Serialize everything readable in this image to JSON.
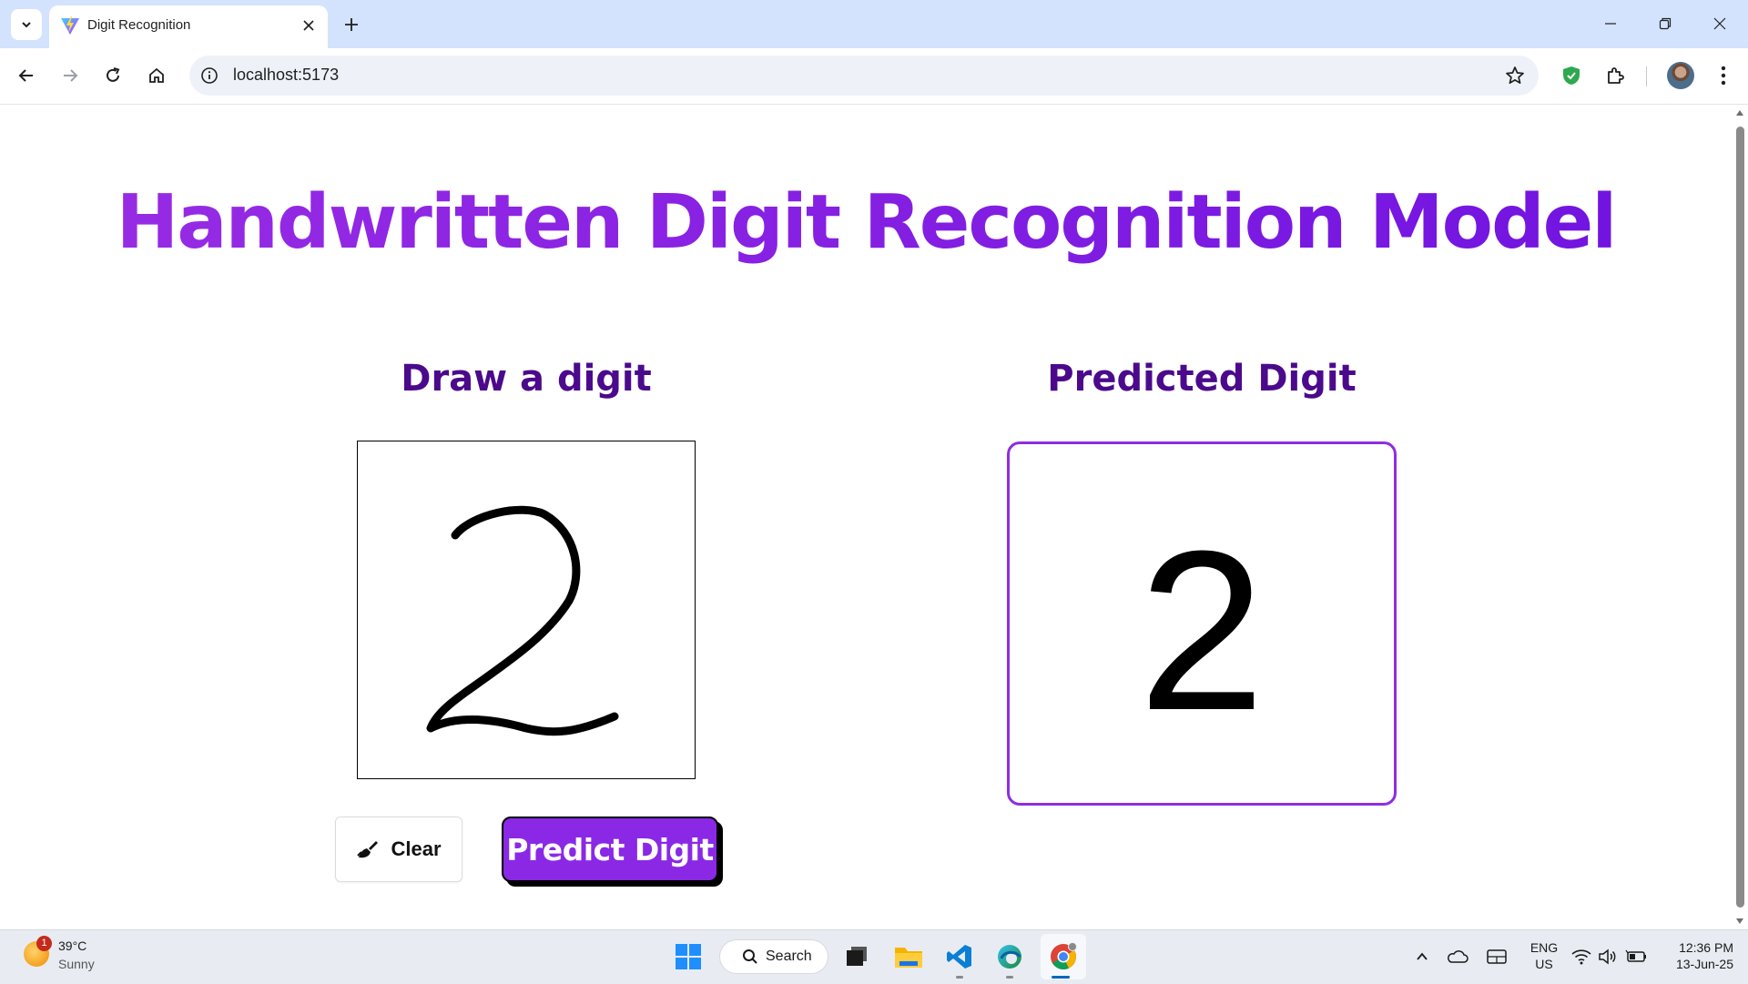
{
  "browser": {
    "tab_title": "Digit Recognition",
    "url": "localhost:5173"
  },
  "page": {
    "title": "Handwritten Digit Recognition Model",
    "draw_heading": "Draw a digit",
    "predicted_heading": "Predicted Digit",
    "predicted_value": "2",
    "clear_label": "Clear",
    "predict_label": "Predict Digit"
  },
  "taskbar": {
    "weather_badge": "1",
    "weather_temp": "39°C",
    "weather_condition": "Sunny",
    "search_label": "Search",
    "lang_primary": "ENG",
    "lang_secondary": "US",
    "time": "12:36 PM",
    "date": "13-Jun-25"
  },
  "colors": {
    "title_gradient_start": "#9a2de5",
    "title_gradient_end": "#6f12e0",
    "heading": "#4b0a8c",
    "predict_button": "#8b28e6",
    "predicted_border": "#8e2de2",
    "browser_frame": "#d3e3fd"
  },
  "icons": [
    "tab-list-icon",
    "vite-favicon-icon",
    "close-icon",
    "plus-icon",
    "minimize-icon",
    "restore-icon",
    "back-icon",
    "forward-icon",
    "reload-icon",
    "home-icon",
    "info-icon",
    "star-icon",
    "shield-icon",
    "extensions-icon",
    "menu-icon",
    "brush-icon",
    "windows-start-icon",
    "search-icon",
    "task-view-icon",
    "file-explorer-icon",
    "vscode-icon",
    "edge-icon",
    "chrome-icon",
    "chevron-up-icon",
    "onedrive-icon",
    "keyboard-icon",
    "wifi-icon",
    "volume-icon",
    "battery-icon"
  ]
}
